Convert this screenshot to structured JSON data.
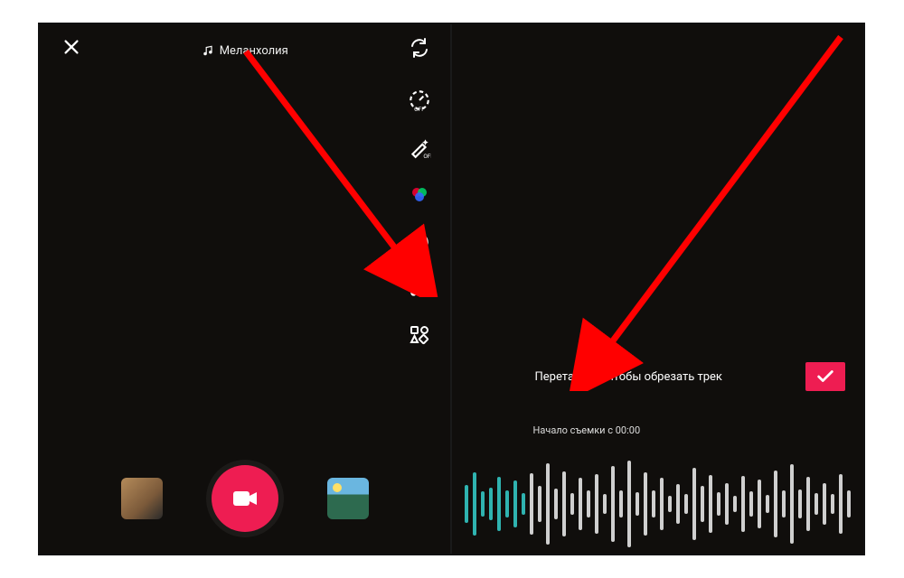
{
  "left": {
    "music_label": "Меланхолия",
    "tools": {
      "flip": "flip",
      "speed": "speed-off",
      "beauty": "beauty-off",
      "filters": "filters",
      "timer": "timer-3",
      "sound_cut": "sound-cut",
      "more": "more-grid"
    }
  },
  "right": {
    "trim_hint": "Перетащите, чтобы обрезать трек",
    "start_label": "Начало съемки с 00:00"
  },
  "waveform": {
    "teal_bars": [
      42,
      70,
      28,
      36,
      60,
      30,
      52,
      24
    ],
    "grey_bars": [
      68,
      40,
      90,
      34,
      72,
      24,
      58,
      30,
      66,
      22,
      84,
      30,
      96,
      26,
      70,
      30,
      58,
      18,
      44,
      22,
      80,
      40,
      64,
      26,
      46,
      18,
      62,
      28,
      54,
      20,
      74,
      30,
      88,
      32,
      60,
      24,
      46,
      22,
      66,
      30
    ]
  },
  "colors": {
    "accent": "#ee1d52",
    "teal": "#2fb3b0"
  }
}
